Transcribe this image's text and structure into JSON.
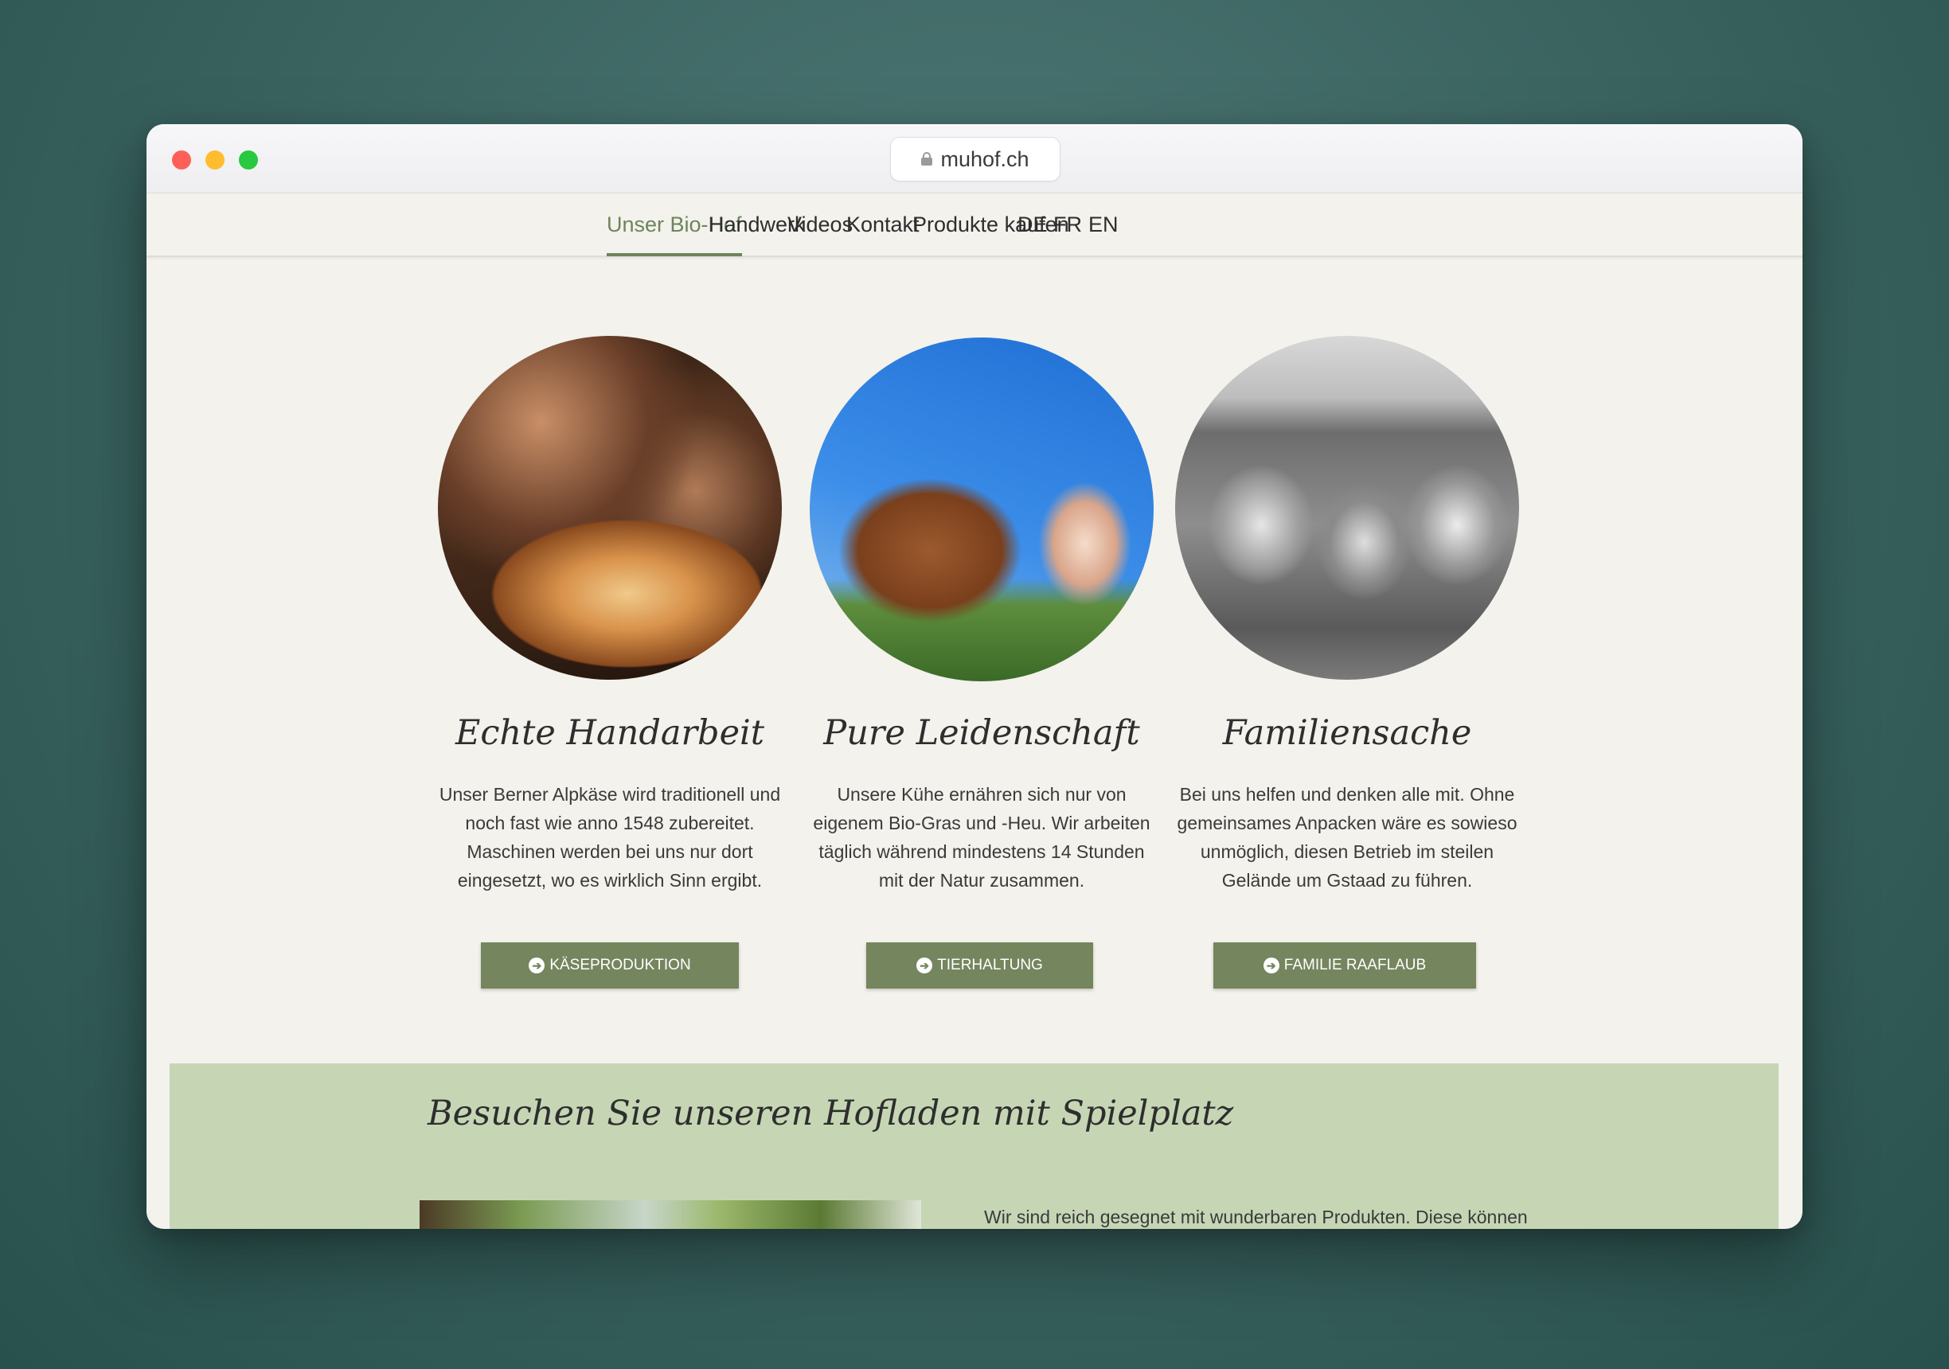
{
  "browser": {
    "url": "muhof.ch"
  },
  "nav": {
    "items": [
      {
        "label": "Unser Bio-Hof",
        "active": true
      },
      {
        "label": "Handwerk"
      },
      {
        "label": "Videos"
      },
      {
        "label": "Kontakt"
      },
      {
        "label": "Produkte kaufen"
      }
    ],
    "languages": [
      "DE",
      "FR",
      "EN"
    ]
  },
  "features": [
    {
      "title": "Echte Handarbeit",
      "lines": [
        "Unser Berner Alpkäse wird traditionell und",
        "noch fast wie anno 1548 zubereitet.",
        "Maschinen werden bei uns nur dort",
        "eingesetzt, wo es wirklich Sinn ergibt."
      ],
      "button": "KÄSEPRODUKTION"
    },
    {
      "title": "Pure Leidenschaft",
      "lines": [
        "Unsere Kühe ernähren sich nur von",
        "eigenem Bio-Gras und -Heu. Wir arbeiten",
        "täglich während mindestens 14 Stunden",
        "mit der Natur zusammen."
      ],
      "button": "TIERHALTUNG"
    },
    {
      "title": "Familiensache",
      "lines": [
        "Bei uns helfen und denken alle mit. Ohne",
        "gemeinsames Anpacken wäre es sowieso",
        "unmöglich, diesen Betrieb im steilen",
        "Gelände um Gstaad zu führen."
      ],
      "button": "FAMILIE RAAFLAUB"
    }
  ],
  "visit": {
    "title": "Besuchen Sie unseren Hofladen mit Spielplatz",
    "text": "Wir sind reich gesegnet mit wunderbaren Produkten. Diese können"
  },
  "colors": {
    "accent": "#6e845c",
    "button": "#75855e",
    "page_bg": "#f3f2ec",
    "section_bg": "#c6d6b5"
  },
  "icons": {
    "button_icon": "arrow-circle-right-icon",
    "url_icon": "lock-icon"
  }
}
